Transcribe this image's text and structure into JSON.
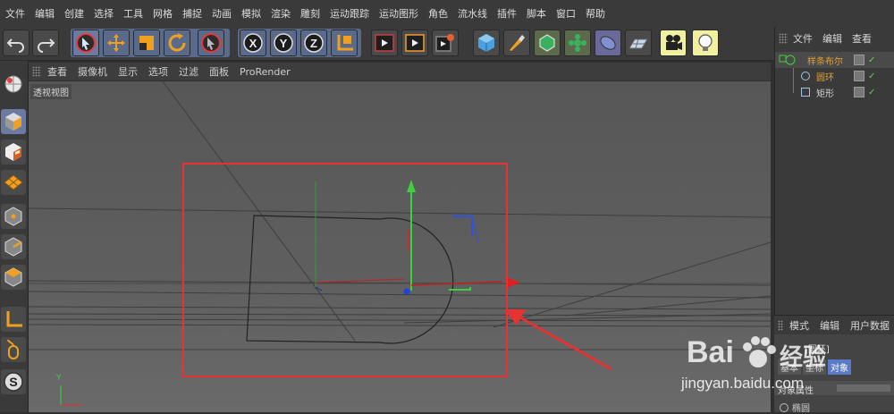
{
  "menubar": [
    "文件",
    "编辑",
    "创建",
    "选择",
    "工具",
    "网格",
    "捕捉",
    "动画",
    "模拟",
    "渲染",
    "雕刻",
    "运动跟踪",
    "运动图形",
    "角色",
    "流水线",
    "插件",
    "脚本",
    "窗口",
    "帮助"
  ],
  "viewport": {
    "menu": [
      "查看",
      "摄像机",
      "显示",
      "选项",
      "过滤",
      "面板",
      "ProRender"
    ],
    "label": "透视视图",
    "axis_y": "Y",
    "axis_x": "X"
  },
  "objects_panel": {
    "menu": [
      "文件",
      "编辑",
      "查看"
    ],
    "items": [
      "样条布尔",
      "圆环",
      "矩形"
    ],
    "colors": {
      "active": "#e8a030",
      "child": "#9fc4e8"
    }
  },
  "attributes_panel": {
    "menu": [
      "模式",
      "编辑",
      "用户数据"
    ],
    "title": "[圆环]",
    "tabs": [
      "基本",
      "坐标",
      "对象"
    ],
    "section": "对象属性",
    "option": "椭圆"
  },
  "watermark": {
    "brand": "Bai",
    "brand2": "经验",
    "url": "jingyan.baidu.com"
  },
  "colors": {
    "highlight_box": "#e53333",
    "arrow": "#e53333",
    "accent": "#e8a030"
  }
}
